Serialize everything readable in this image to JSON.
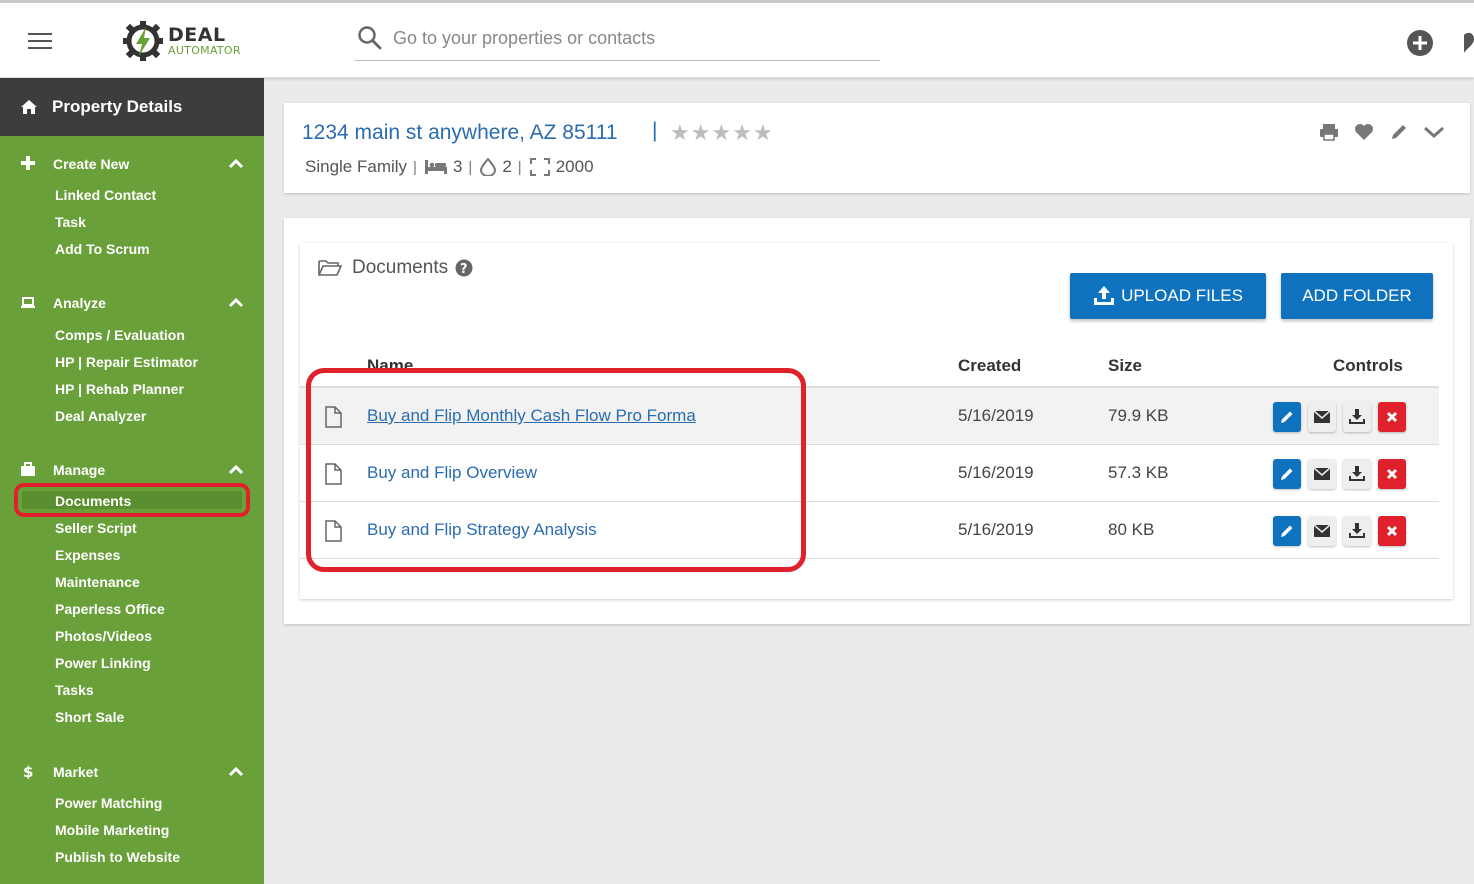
{
  "header": {
    "brand_line1": "DEAL",
    "brand_line2": "AUTOMATOR",
    "search_placeholder": "Go to your properties or contacts"
  },
  "sidebar": {
    "title": "Property Details",
    "sections": [
      {
        "label": "Create New",
        "items": [
          "Linked Contact",
          "Task",
          "Add To Scrum"
        ]
      },
      {
        "label": "Analyze",
        "items": [
          "Comps / Evaluation",
          "HP | Repair Estimator",
          "HP | Rehab Planner",
          "Deal Analyzer"
        ]
      },
      {
        "label": "Manage",
        "items": [
          "Documents",
          "Seller Script",
          "Expenses",
          "Maintenance",
          "Paperless Office",
          "Photos/Videos",
          "Power Linking",
          "Tasks",
          "Short Sale"
        ]
      },
      {
        "label": "Market",
        "items": [
          "Power Matching",
          "Mobile Marketing",
          "Publish to Website"
        ]
      }
    ],
    "active_item": "Documents"
  },
  "property": {
    "address": "1234 main st anywhere, AZ 85111",
    "separator": "|",
    "stars": [
      "★",
      "★",
      "★",
      "★",
      "★"
    ],
    "type": "Single Family",
    "beds": "3",
    "baths": "2",
    "sqft": "2000",
    "pipe": "|"
  },
  "documents": {
    "title": "Documents",
    "upload_label": "UPLOAD FILES",
    "add_folder_label": "ADD FOLDER",
    "columns": {
      "name": "Name",
      "created": "Created",
      "size": "Size",
      "controls": "Controls"
    },
    "rows": [
      {
        "name": "Buy and Flip Monthly Cash Flow Pro Forma",
        "created": "5/16/2019",
        "size": "79.9 KB"
      },
      {
        "name": "Buy and Flip Overview",
        "created": "5/16/2019",
        "size": "57.3 KB"
      },
      {
        "name": "Buy and Flip Strategy Analysis",
        "created": "5/16/2019",
        "size": "80 KB"
      }
    ]
  },
  "colors": {
    "sidebar_green": "#69a03a",
    "sidebar_dark": "#3d3d3d",
    "accent_blue": "#0e72be",
    "link_blue": "#2a6cb0",
    "danger_red": "#e0202a"
  }
}
